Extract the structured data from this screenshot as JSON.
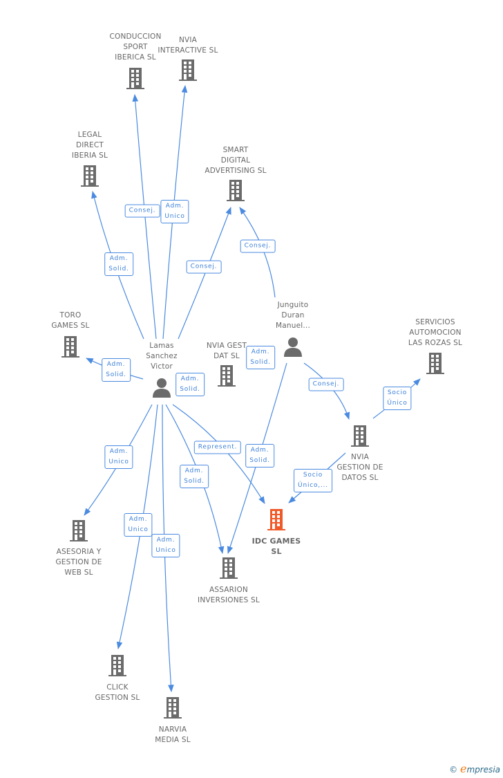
{
  "colors": {
    "edge": "#4a8ae0",
    "node": "#6b6b6b",
    "focus": "#f05a28"
  },
  "nodes": [
    {
      "name": "CONDUCCION\nSPORT\nIBERICA SL",
      "type": "company"
    },
    {
      "name": "NVIA\nINTERACTIVE SL",
      "type": "company"
    },
    {
      "name": "LEGAL\nDIRECT\nIBERIA SL",
      "type": "company"
    },
    {
      "name": "SMART\nDIGITAL\nADVERTISING SL",
      "type": "company"
    },
    {
      "name": "TORO\nGAMES SL",
      "type": "company"
    },
    {
      "name": "Lamas\nSanchez\nVictor",
      "type": "person"
    },
    {
      "name": "NVIA GEST\nDAT SL",
      "type": "company"
    },
    {
      "name": "Junguito\nDuran\nManuel...",
      "type": "person"
    },
    {
      "name": "SERVICIOS\nAUTOMOCION\nLAS ROZAS SL",
      "type": "company"
    },
    {
      "name": "NVIA\nGESTION DE\nDATOS SL",
      "type": "company"
    },
    {
      "name": "IDC GAMES\nSL",
      "type": "company",
      "focus": true
    },
    {
      "name": "ASSARION\nINVERSIONES SL",
      "type": "company"
    },
    {
      "name": "ASESORIA Y\nGESTION DE\nWEB SL",
      "type": "company"
    },
    {
      "name": "CLICK\nGESTION SL",
      "type": "company"
    },
    {
      "name": "NARVIA\nMEDIA SL",
      "type": "company"
    }
  ],
  "edges": [
    {
      "from": "Lamas Sanchez Victor",
      "to": "CONDUCCION SPORT IBERICA SL",
      "label": "Consej."
    },
    {
      "from": "Lamas Sanchez Victor",
      "to": "NVIA INTERACTIVE SL",
      "label": "Adm.\nUnico"
    },
    {
      "from": "Lamas Sanchez Victor",
      "to": "LEGAL DIRECT IBERIA SL",
      "label": "Adm.\nSolid."
    },
    {
      "from": "Lamas Sanchez Victor",
      "to": "SMART DIGITAL ADVERTISING SL",
      "label": "Consej."
    },
    {
      "from": "Junguito Duran Manuel...",
      "to": "SMART DIGITAL ADVERTISING SL",
      "label": "Consej."
    },
    {
      "from": "Lamas Sanchez Victor",
      "to": "TORO GAMES SL",
      "label": "Adm.\nSolid."
    },
    {
      "from": "Lamas Sanchez Victor",
      "to": "NVIA GEST DAT SL",
      "label": "Adm.\nSolid."
    },
    {
      "from": "Junguito Duran Manuel...",
      "to": "NVIA GEST DAT SL",
      "label": "Adm.\nSolid."
    },
    {
      "from": "Junguito Duran Manuel...",
      "to": "NVIA GESTION DE DATOS SL",
      "label": "Consej."
    },
    {
      "from": "NVIA GESTION DE DATOS SL",
      "to": "SERVICIOS AUTOMOCION LAS ROZAS SL",
      "label": "Socio\nÚnico"
    },
    {
      "from": "Lamas Sanchez Victor",
      "to": "ASESORIA Y GESTION DE WEB SL",
      "label": "Adm.\nUnico"
    },
    {
      "from": "Lamas Sanchez Victor",
      "to": "IDC GAMES SL",
      "label": "Represent."
    },
    {
      "from": "Junguito Duran Manuel...",
      "to": "ASSARION INVERSIONES SL",
      "label": "Adm.\nSolid."
    },
    {
      "from": "Lamas Sanchez Victor",
      "to": "ASSARION INVERSIONES SL",
      "label": "Adm.\nSolid."
    },
    {
      "from": "NVIA GESTION DE DATOS SL",
      "to": "IDC GAMES SL",
      "label": "Socio\nÚnico,..."
    },
    {
      "from": "Lamas Sanchez Victor",
      "to": "CLICK GESTION SL",
      "label": "Adm.\nUnico"
    },
    {
      "from": "Lamas Sanchez Victor",
      "to": "NARVIA MEDIA SL",
      "label": "Adm.\nUnico"
    }
  ],
  "footer": {
    "copyright": "©",
    "brand_initial": "e",
    "brand_rest": "mpresia"
  }
}
